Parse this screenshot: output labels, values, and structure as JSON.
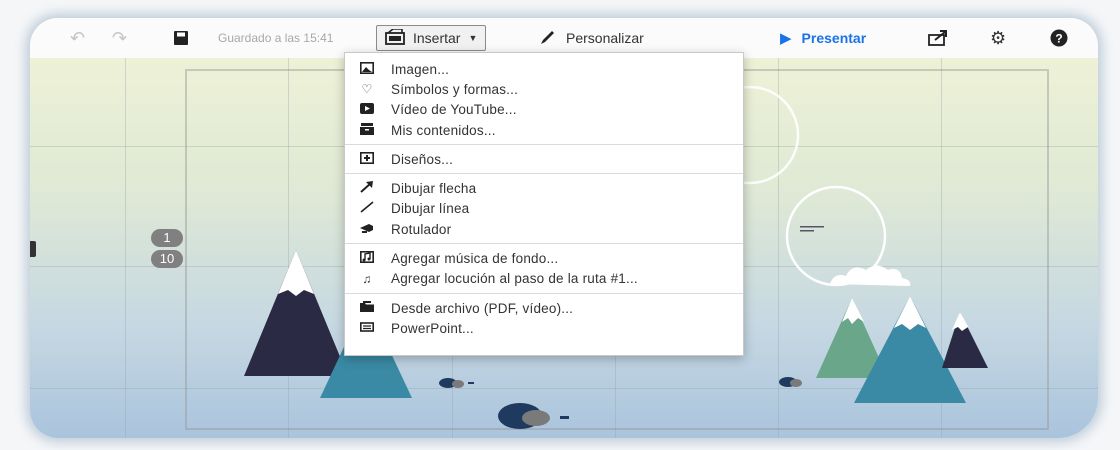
{
  "toolbar": {
    "undo_icon": "undo-arrow-icon",
    "redo_icon": "redo-arrow-icon",
    "save_icon": "floppy-disk-icon",
    "saved_status": "Guardado a las 15:41",
    "insert_label": "Insertar",
    "customize_label": "Personalizar",
    "present_label": "Presentar",
    "share_icon": "share-icon",
    "settings_icon": "gear-icon",
    "help_icon": "help-icon"
  },
  "canvas": {
    "path_badges": [
      "1",
      "10"
    ]
  },
  "menu": {
    "items": [
      {
        "label": "Imagen...",
        "icon": "image-icon"
      },
      {
        "label": "Símbolos y formas...",
        "icon": "shapes-icon"
      },
      {
        "label": "Vídeo de YouTube...",
        "icon": "youtube-icon"
      },
      {
        "label": "Mis contenidos...",
        "icon": "library-icon"
      },
      {
        "label": "Diseños...",
        "icon": "layouts-icon"
      },
      {
        "label": "Dibujar flecha",
        "icon": "arrow-icon"
      },
      {
        "label": "Dibujar línea",
        "icon": "line-icon"
      },
      {
        "label": "Rotulador",
        "icon": "highlighter-icon"
      },
      {
        "label": "Agregar música de fondo...",
        "icon": "music-icon"
      },
      {
        "label": "Agregar locución al paso de la ruta #1...",
        "icon": "note-icon"
      },
      {
        "label": "Desde archivo (PDF, vídeo)...",
        "icon": "folder-icon"
      },
      {
        "label": "PowerPoint...",
        "icon": "powerpoint-icon"
      }
    ]
  },
  "colors": {
    "accent": "#1a73e8",
    "mountain_dark": "#2b2a44",
    "mountain_teal": "#3a8aa5",
    "mountain_green": "#6aa68a"
  }
}
